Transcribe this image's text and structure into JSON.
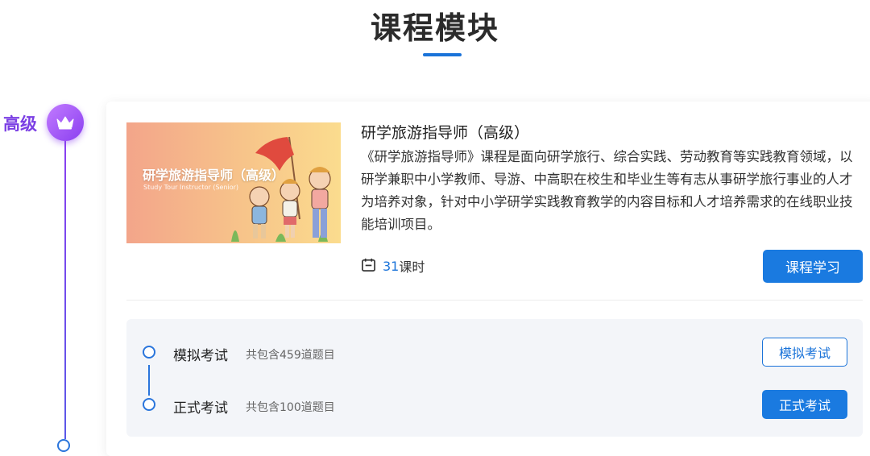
{
  "section": {
    "title": "课程模块"
  },
  "timeline": {
    "level_label": "高级",
    "badge_icon": "crown-icon",
    "accent_color": "#8a3ff0"
  },
  "course": {
    "thumbnail": {
      "title": "研学旅游指导师（高级）",
      "subtitle": "Study Tour Instructor (Senior)"
    },
    "title": "研学旅游指导师（高级）",
    "description": "《研学旅游指导师》课程是面向研学旅行、综合实践、劳动教育等实践教育领域，以研学兼职中小学教师、导游、中高职在校生和毕业生等有志从事研学旅行事业的人才为培养对象，针对中小学研学实践教育教学的内容目标和人才培养需求的在线职业技能培训项目。",
    "lessons_icon": "calendar-icon",
    "lessons_count": "31",
    "lessons_unit": "课时",
    "study_button": "课程学习"
  },
  "exams": [
    {
      "name": "模拟考试",
      "count_text": "共包含459道题目",
      "button": "模拟考试"
    },
    {
      "name": "正式考试",
      "count_text": "共包含100道题目",
      "button": "正式考试"
    }
  ],
  "colors": {
    "primary": "#1a7ae0",
    "title": "#2b2b2b",
    "panel_bg": "#f3f5f9"
  }
}
